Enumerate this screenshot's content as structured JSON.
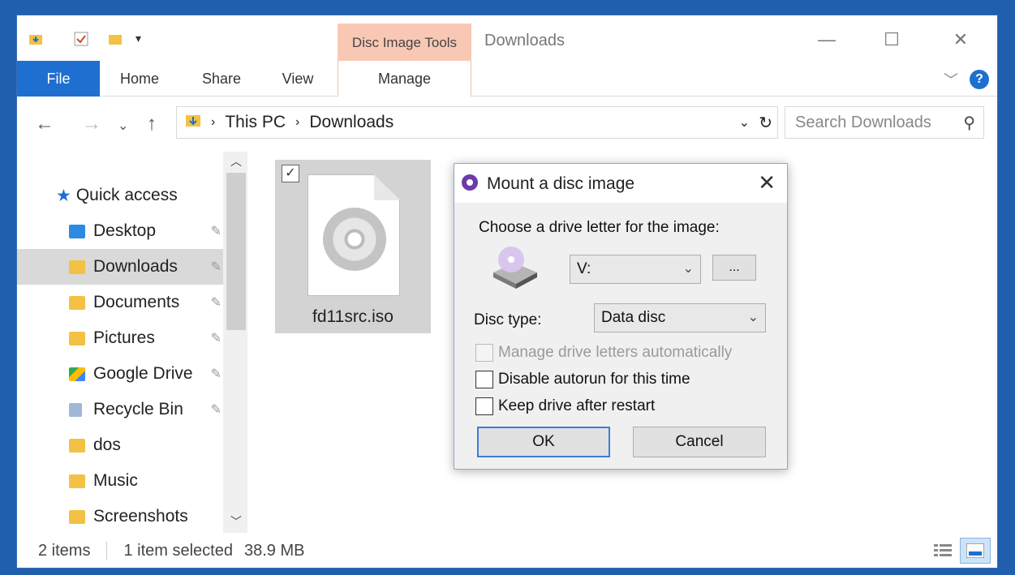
{
  "window": {
    "title": "Downloads",
    "contextual_tab": "Disc Image Tools",
    "minimize": "—",
    "maximize": "☐",
    "close": "✕"
  },
  "ribbon": {
    "tabs": [
      "File",
      "Home",
      "Share",
      "View",
      "Manage"
    ],
    "help": "?"
  },
  "address": {
    "crumbs": [
      "This PC",
      "Downloads"
    ],
    "search_placeholder": "Search Downloads"
  },
  "nav": {
    "items": [
      {
        "label": "Quick access",
        "icon": "star-icon"
      },
      {
        "label": "Desktop",
        "icon": "desktop-folder-icon",
        "pinned": true
      },
      {
        "label": "Downloads",
        "icon": "downloads-folder-icon",
        "pinned": true,
        "selected": true
      },
      {
        "label": "Documents",
        "icon": "documents-folder-icon",
        "pinned": true
      },
      {
        "label": "Pictures",
        "icon": "pictures-folder-icon",
        "pinned": true
      },
      {
        "label": "Google Drive",
        "icon": "google-drive-folder-icon",
        "pinned": true
      },
      {
        "label": "Recycle Bin",
        "icon": "recycle-bin-icon",
        "pinned": true
      },
      {
        "label": "dos",
        "icon": "folder-icon"
      },
      {
        "label": "Music",
        "icon": "music-folder-icon"
      },
      {
        "label": "Screenshots",
        "icon": "folder-icon"
      }
    ]
  },
  "files": [
    {
      "name": "fd11src.iso",
      "checked": true
    }
  ],
  "status": {
    "items": "2 items",
    "selected": "1 item selected",
    "size": "38.9 MB"
  },
  "dialog": {
    "title": "Mount a disc image",
    "drive_prompt": "Choose a drive letter for the image:",
    "drive_value": "V:",
    "browse_label": "...",
    "disc_type_label": "Disc type:",
    "disc_type_value": "Data disc",
    "checkboxes": [
      {
        "label": "Manage drive letters automatically",
        "checked": false,
        "disabled": true
      },
      {
        "label": "Disable autorun for this time",
        "checked": false,
        "disabled": false
      },
      {
        "label": "Keep drive after restart",
        "checked": false,
        "disabled": false
      }
    ],
    "ok": "OK",
    "cancel": "Cancel"
  },
  "colors": {
    "accent": "#1e6fd0",
    "contextual_tab": "#f9c8b4",
    "selection": "#d9d9d9"
  }
}
